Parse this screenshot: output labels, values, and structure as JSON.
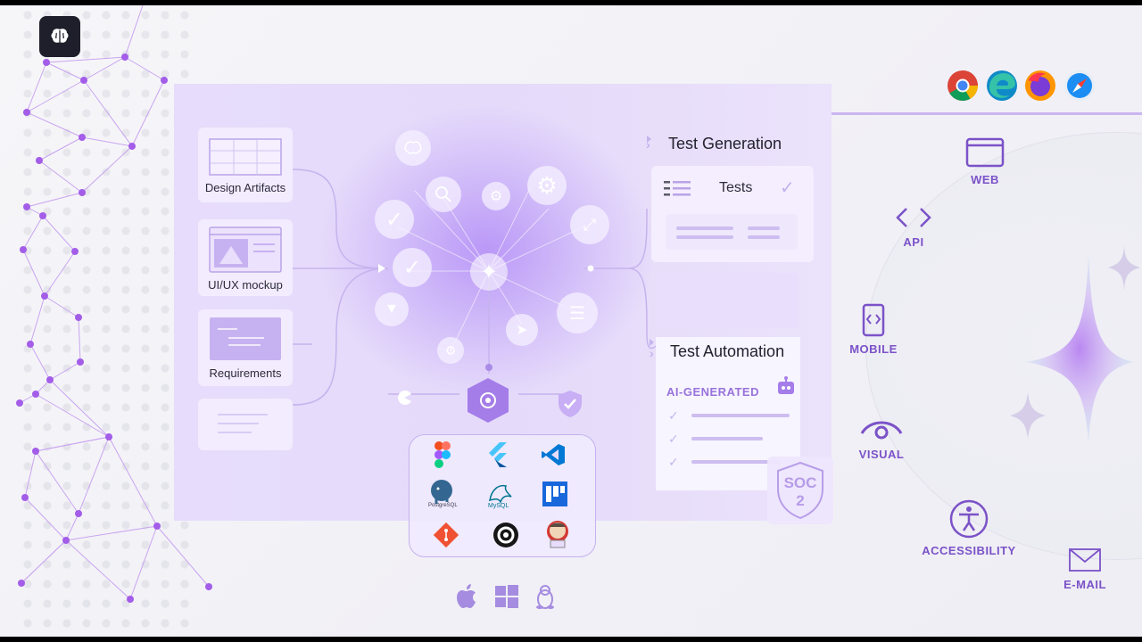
{
  "artifacts": [
    {
      "label": "Design Artifacts"
    },
    {
      "label": "UI/UX mockup"
    },
    {
      "label": "Requirements"
    }
  ],
  "test_generation": {
    "heading": "Test Generation",
    "tests_label": "Tests"
  },
  "test_automation": {
    "heading": "Test Automation",
    "badge": "AI-GENERATED"
  },
  "soc": {
    "line1": "SOC",
    "line2": "2"
  },
  "categories": [
    {
      "label": "WEB",
      "icon": "window-icon"
    },
    {
      "label": "API",
      "icon": "code-icon"
    },
    {
      "label": "MOBILE",
      "icon": "mobile-icon"
    },
    {
      "label": "VISUAL",
      "icon": "eye-icon"
    },
    {
      "label": "ACCESSIBILITY",
      "icon": "accessibility-icon"
    },
    {
      "label": "E-MAIL",
      "icon": "envelope-icon"
    }
  ],
  "browsers": [
    "chrome-icon",
    "edge-icon",
    "firefox-icon",
    "safari-icon"
  ],
  "tools": [
    "figma-icon",
    "flutter-icon",
    "vscode-icon",
    "postgresql-icon",
    "mysql-icon",
    "jira-icon",
    "git-icon",
    "circleci-icon",
    "jenkins-icon"
  ],
  "tool_captions": {
    "postgres": "PostgreSQL",
    "mysql": "MySQL"
  },
  "os": [
    "apple-icon",
    "windows-icon",
    "linux-icon"
  ],
  "colors": {
    "accent": "#7b52c8",
    "panel": "#e7dcfb",
    "node": "#a074e8"
  }
}
